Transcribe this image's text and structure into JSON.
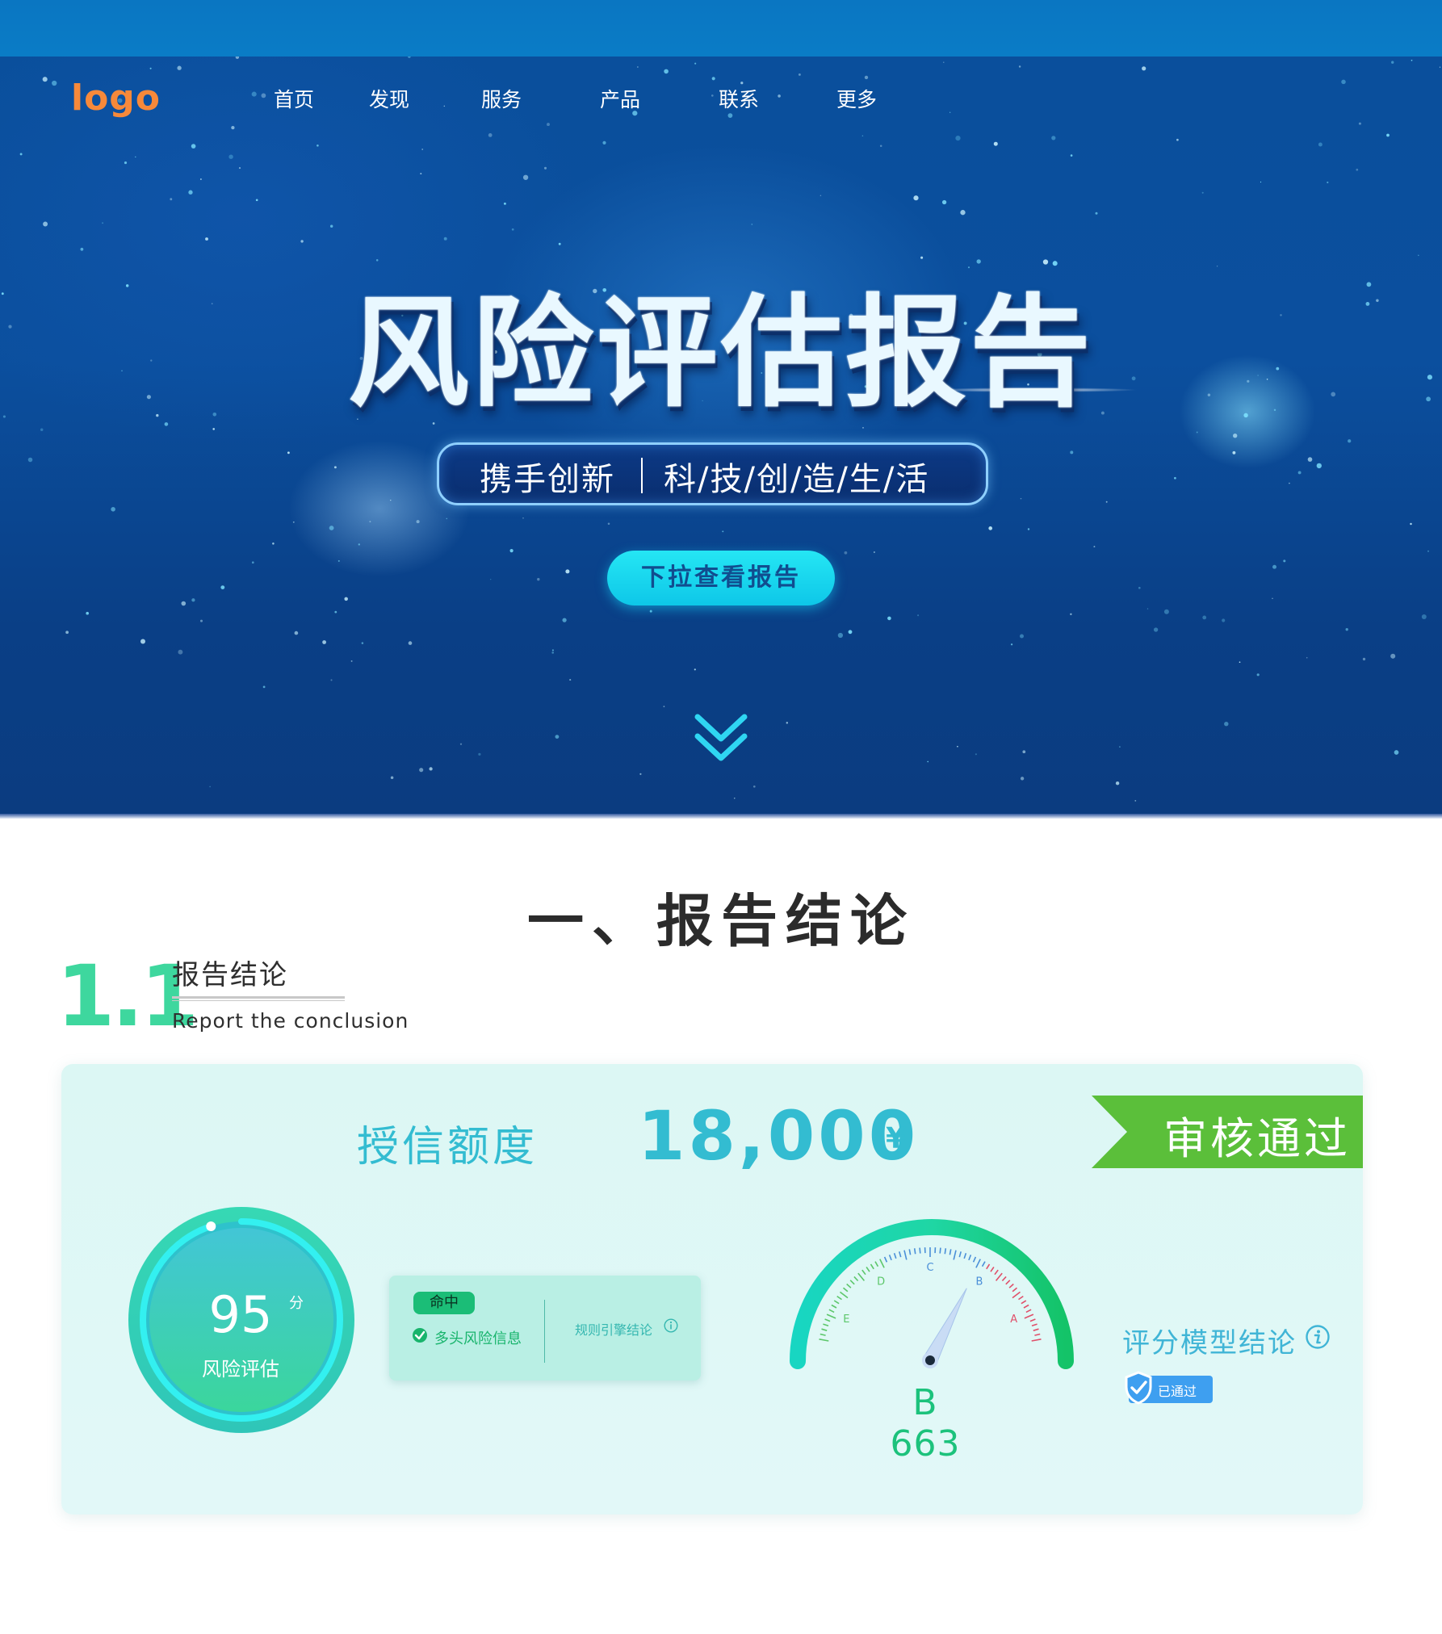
{
  "header": {
    "logo": "logo",
    "nav": [
      "首页",
      "发现",
      "服务",
      "产品",
      "联系",
      "更多"
    ]
  },
  "hero": {
    "title": "风险评估报告",
    "slogan_left": "携手创新",
    "slogan_right": "科/技/创/造/生/活",
    "cta": "下拉查看报告",
    "scroll_icon": "double-chevron-down-icon"
  },
  "section": {
    "title": "一、报告结论",
    "sub_number": "1.1",
    "sub_title": "报告结论",
    "sub_title_en": "Report the conclusion"
  },
  "card": {
    "credit_label": "授信额度",
    "credit_value": "18,000",
    "currency": "¥",
    "status": "审核通过",
    "score": {
      "value": "95",
      "unit": "分",
      "label": "风险评估",
      "level": 0.95
    },
    "hit_panel": {
      "badge": "命中",
      "item": "多头风险信息",
      "rule": "规则引擎结论",
      "rule_icon": "info-icon"
    },
    "meter": {
      "grades": [
        "E",
        "D",
        "C",
        "B",
        "A"
      ],
      "grade": "B",
      "score": 663,
      "display": "B 663"
    },
    "model": {
      "label": "评分模型结论",
      "info_icon": "info-icon",
      "badge": "已通过",
      "badge_icon": "shield-check-icon"
    }
  },
  "colors": {
    "hero_bg": "#0b4f9e",
    "accent_cyan": "#33bcd1",
    "accent_green": "#3ed79e",
    "ribbon_green": "#5bbf3a",
    "logo_orange": "#f7893a"
  }
}
